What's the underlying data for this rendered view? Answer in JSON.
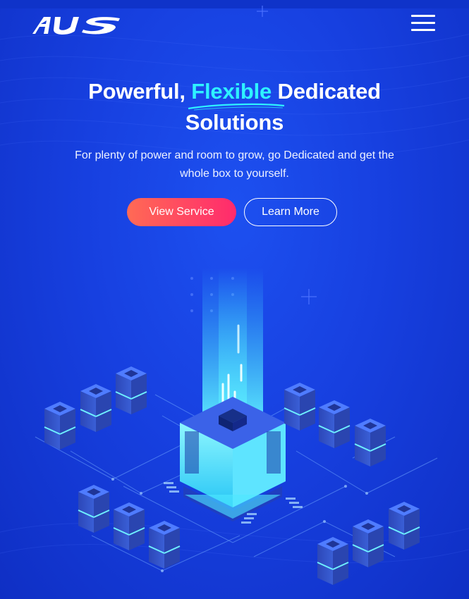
{
  "header": {
    "logo_text": "AUS",
    "menu_icon": "hamburger-menu-icon"
  },
  "hero": {
    "title_part1": "Powerful, ",
    "title_accent": "Flexible",
    "title_part2": " Dedicated Solutions",
    "subtitle": "For plenty of power and room to grow, go Dedicated and get the whole box to yourself.",
    "primary_button": "View Service",
    "secondary_button": "Learn More"
  },
  "colors": {
    "background": "#1740e0",
    "accent_cyan": "#2ef2ff",
    "button_gradient_start": "#ff6a55",
    "button_gradient_end": "#ff2a6d"
  },
  "illustration": {
    "name": "isometric-server-network-illustration"
  }
}
